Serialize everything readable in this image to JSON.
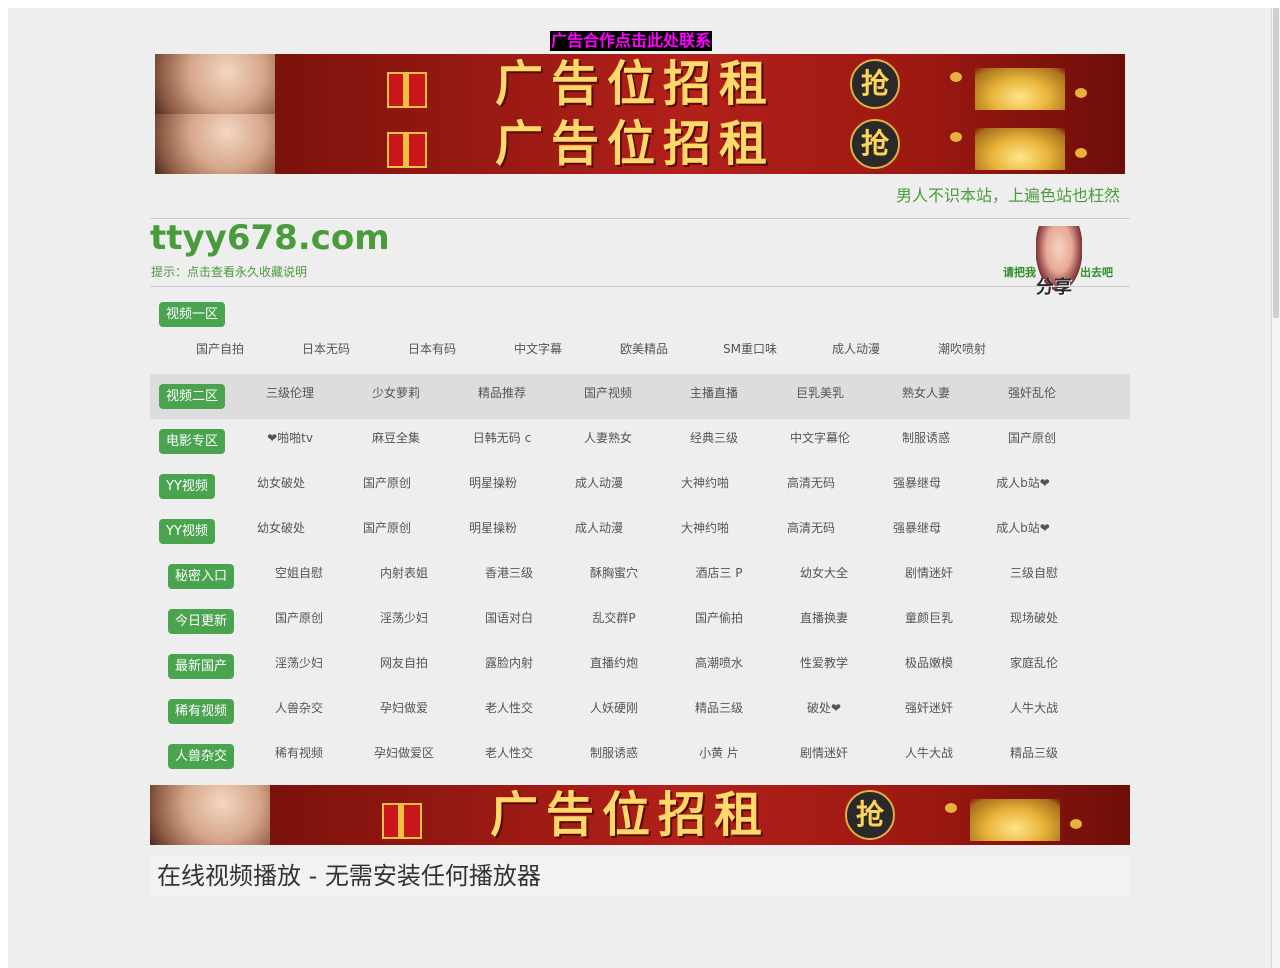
{
  "top_ad_link": "广告合作点击此处联系",
  "banners": {
    "text": "广告位招租",
    "grab": "抢"
  },
  "header": {
    "slogan": "男人不识本站，上遍色站也枉然",
    "logo": "ttyy678.com",
    "tip": "提示：点击查看永久收藏说明",
    "share_left": "请把我",
    "share_right": "出去吧",
    "share_main": "分享"
  },
  "nav": [
    {
      "category": "视频一区",
      "links": [
        "国产自拍",
        "日本无码",
        "日本有码",
        "中文字幕",
        "欧美精品",
        "SM重口味",
        "成人动漫",
        "潮吹喷射"
      ]
    },
    {
      "category": "视频二区",
      "links": [
        "三级伦理",
        "少女萝莉",
        "精品推荐",
        "国产视频",
        "主播直播",
        "巨乳美乳",
        "熟女人妻",
        "强奸乱伦"
      ]
    },
    {
      "category": "电影专区",
      "links": [
        "❤啪啪tv",
        "麻豆全集",
        "日韩无码 c",
        "人妻熟女",
        "经典三级",
        "中文字幕伦",
        "制服诱惑",
        "国产原创"
      ]
    },
    {
      "category": "YY视频",
      "links": [
        "幼女破处",
        "国产原创",
        "明星操粉",
        "成人动漫",
        "大神约啪",
        "高清无码",
        "强暴继母",
        "成人b站❤"
      ]
    },
    {
      "category": "YY视频",
      "links": [
        "幼女破处",
        "国产原创",
        "明星操粉",
        "成人动漫",
        "大神约啪",
        "高清无码",
        "强暴继母",
        "成人b站❤"
      ]
    },
    {
      "category": "秘密入口",
      "links": [
        "空姐自慰",
        "内射表姐",
        "香港三级",
        "酥胸蜜穴",
        "酒店三 P",
        "幼女大全",
        "剧情迷奸",
        "三级自慰"
      ]
    },
    {
      "category": "今日更新",
      "links": [
        "国产原创",
        "淫荡少妇",
        "国语对白",
        "乱交群P",
        "国产偷拍",
        "直播换妻",
        "童颜巨乳",
        "现场破处"
      ]
    },
    {
      "category": "最新国产",
      "links": [
        "淫荡少妇",
        "网友自拍",
        "露脸内射",
        "直播约炮",
        "高潮喷水",
        "性爱教学",
        "极品嫩模",
        "家庭乱伦"
      ]
    },
    {
      "category": "稀有视频",
      "links": [
        "人兽杂交",
        "孕妇做爱",
        "老人性交",
        "人妖硬刚",
        "精品三级",
        "破处❤",
        "强奸迷奸",
        "人牛大战"
      ]
    },
    {
      "category": "人兽杂交",
      "links": [
        "稀有视频",
        "孕妇做爱区",
        "老人性交",
        "制服诱惑",
        "小黄 片",
        "剧情迷奸",
        "人牛大战",
        "精品三级"
      ]
    }
  ],
  "footer": {
    "title": "在线视频播放 - 无需安装任何播放器"
  },
  "colors": {
    "green": "#4aa34f",
    "slogan_green": "#4a9b3c",
    "ad_link_fg": "#ff00ff",
    "ad_link_bg": "#000000"
  }
}
